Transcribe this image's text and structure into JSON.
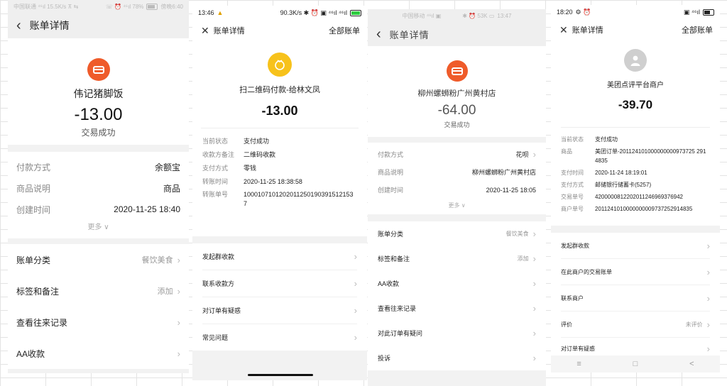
{
  "screens": [
    {
      "status_left": "中国联通 ⁴⁶ıl 15.5K/s ⊼ ⇆",
      "status_right": "☏ ⏰ ⁴⁶ıl 78%",
      "status_time": "傍晚6:40",
      "header_title": "账单详情",
      "merchant": "伟记猪脚饭",
      "amount": "-13.00",
      "status_text": "交易成功",
      "details": [
        {
          "label": "付款方式",
          "value": "余额宝"
        },
        {
          "label": "商品说明",
          "value": "商品"
        },
        {
          "label": "创建时间",
          "value": "2020-11-25 18:40"
        }
      ],
      "more": "更多",
      "actions": [
        {
          "label": "账单分类",
          "value": "餐饮美食"
        },
        {
          "label": "标签和备注",
          "value": "添加"
        },
        {
          "label": "查看往来记录",
          "value": ""
        },
        {
          "label": "AA收款",
          "value": ""
        }
      ]
    },
    {
      "status_time": "13:46",
      "status_right": "90.3K/s ✱ ⏰ ▣ ⁴⁶ıl ⁴⁶ıl",
      "header_title": "账单详情",
      "header_right": "全部账单",
      "merchant": "扫二维码付款-给林文凤",
      "amount": "-13.00",
      "details": [
        {
          "label": "当前状态",
          "value": "支付成功"
        },
        {
          "label": "收款方备注",
          "value": "二维码收款"
        },
        {
          "label": "支付方式",
          "value": "零钱"
        },
        {
          "label": "转账时间",
          "value": "2020-11-25 18:38:58"
        },
        {
          "label": "转账单号",
          "value": "1000107101202011250190391512153 7"
        }
      ],
      "actions": [
        {
          "label": "发起群收款"
        },
        {
          "label": "联系收款方"
        },
        {
          "label": "对订单有疑惑"
        },
        {
          "label": "常见问题"
        }
      ]
    },
    {
      "status_left": "中国移动 ⁴⁶ıl ▣",
      "status_right": "✱ ⏰ 53K ▭",
      "status_time": "13:47",
      "header_title": "账单详情",
      "merchant": "柳州螺蛳粉广州黄村店",
      "amount": "-64.00",
      "status_text": "交易成功",
      "details": [
        {
          "label": "付款方式",
          "value": "花呗"
        },
        {
          "label": "商品说明",
          "value": "柳州螺蛳粉广州黄村店"
        },
        {
          "label": "创建时间",
          "value": "2020-11-25 18:05"
        }
      ],
      "more": "更多",
      "actions": [
        {
          "label": "账单分类",
          "value": "餐饮美食"
        },
        {
          "label": "标签和备注",
          "value": "添加"
        },
        {
          "label": "AA收款",
          "value": ""
        },
        {
          "label": "查看往来记录",
          "value": ""
        },
        {
          "label": "对此订单有疑问",
          "value": ""
        },
        {
          "label": "投诉",
          "value": ""
        }
      ]
    },
    {
      "status_time": "18:20",
      "status_left_icons": "⚙ ⏰",
      "status_right": "▣ ⁴⁶ıl",
      "header_title": "账单详情",
      "header_right": "全部账单",
      "merchant": "美团点评平台商户",
      "amount": "-39.70",
      "details": [
        {
          "label": "当前状态",
          "value": "支付成功"
        },
        {
          "label": "商品",
          "value": "美团订单-201124101000000000973725 2914835"
        },
        {
          "label": "支付时间",
          "value": "2020-11-24 18:19:01"
        },
        {
          "label": "支付方式",
          "value": "邮储银行储蓄卡(5257)"
        },
        {
          "label": "交易单号",
          "value": "4200000812202011246969376942"
        },
        {
          "label": "商户单号",
          "value": "2011241010000000009737252914835"
        }
      ],
      "actions": [
        {
          "label": "发起群收款",
          "value": ""
        },
        {
          "label": "在此商户的交易账单",
          "value": ""
        },
        {
          "label": "联系商户",
          "value": ""
        },
        {
          "label": "评价",
          "value": "未评价"
        },
        {
          "label": "对订单有疑惑",
          "value": ""
        }
      ],
      "nav": [
        "≡",
        "□",
        "<"
      ]
    }
  ],
  "colors": {
    "alipay_orange": "#ef5b2a",
    "wechat_yellow": "#f7c21b",
    "avatar_gray": "#cfcfcf"
  }
}
